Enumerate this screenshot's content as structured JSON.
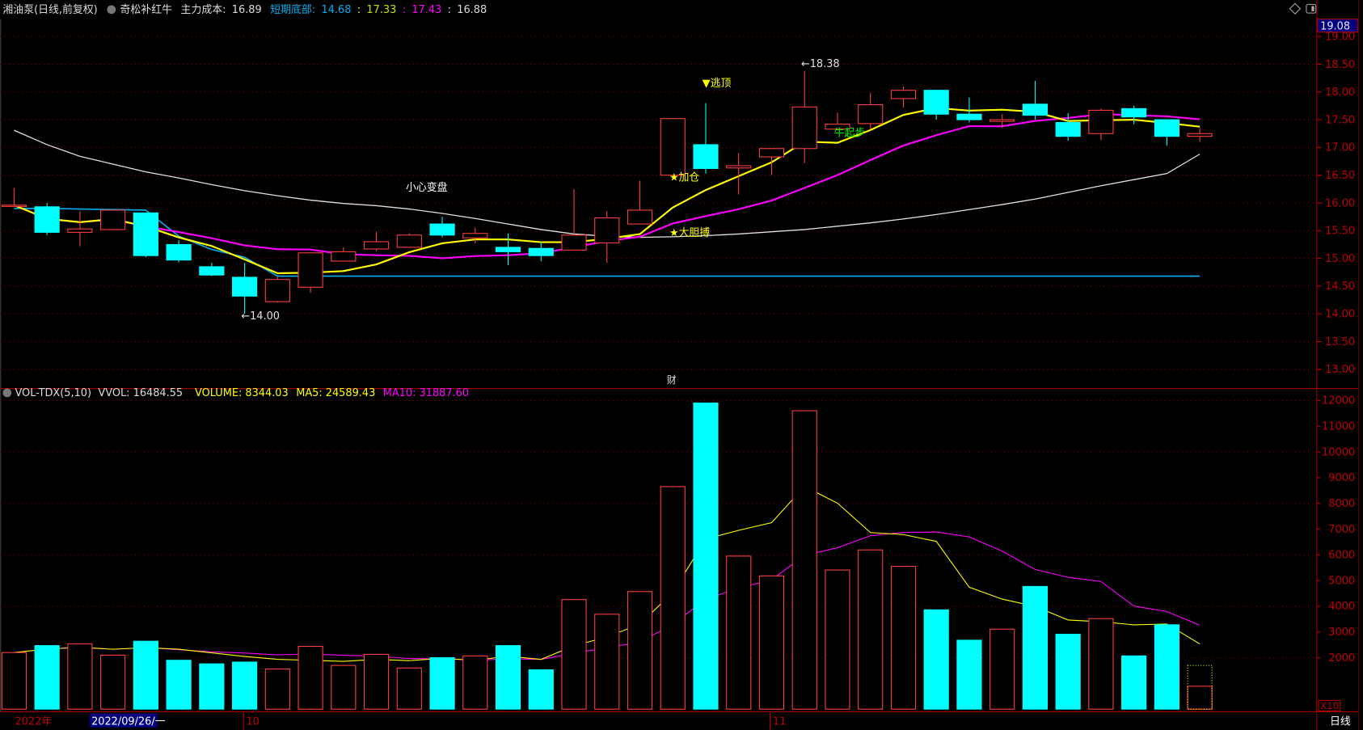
{
  "header": {
    "stock": "湘油泵(日线,前复权)",
    "indicator": "奇松补红牛",
    "cost_label": "主力成本:",
    "cost_value": "16.89",
    "bottom_label": "短期底部:",
    "v1": "14.68",
    "v2": "17.33",
    "v3": "17.43",
    "v4": "16.88",
    "sep": ":"
  },
  "volume_header": {
    "name": "VOL-TDX(5,10)",
    "vvol": "VVOL: 16484.55",
    "volume": "VOLUME: 8344.03",
    "ma5": "MA5: 24589.43",
    "ma10": "MA10: 31887.60"
  },
  "cursor_price": "19.08",
  "volume_unit": "X10",
  "footer": {
    "year": "2022年",
    "cursor_date": "2022/09/26/一",
    "month_10": "10",
    "month_11": "11",
    "period": "日线"
  },
  "finance_marker": "财",
  "colors": {
    "up": "#ff4040",
    "down": "#00ffff",
    "ma_short": "#ffff00",
    "ma_mid": "#ff00ff",
    "ma_long": "#e0e0e0",
    "bottom_line": "#00b0f0",
    "axis": "#c00000",
    "grid": "#800000"
  },
  "chart_data": [
    {
      "type": "candlestick",
      "ylim": [
        13.0,
        19.0
      ],
      "yticks": [
        "19.00",
        "18.50",
        "18.00",
        "17.50",
        "17.00",
        "16.50",
        "16.00",
        "15.50",
        "15.00",
        "14.50",
        "14.00",
        "13.50",
        "13.00"
      ],
      "grid": true,
      "candles_ohlc": [
        [
          15.95,
          16.27,
          15.93,
          15.96
        ],
        [
          15.93,
          16.0,
          15.42,
          15.47
        ],
        [
          15.47,
          15.85,
          15.22,
          15.53
        ],
        [
          15.52,
          15.87,
          15.52,
          15.87
        ],
        [
          15.82,
          15.82,
          15.02,
          15.05
        ],
        [
          15.25,
          15.33,
          14.93,
          14.97
        ],
        [
          14.85,
          14.92,
          14.68,
          14.7
        ],
        [
          14.66,
          14.92,
          14.0,
          14.32
        ],
        [
          14.22,
          14.67,
          14.2,
          14.62
        ],
        [
          14.48,
          15.1,
          14.38,
          15.1
        ],
        [
          14.95,
          15.2,
          14.95,
          15.12
        ],
        [
          15.17,
          15.48,
          15.13,
          15.3
        ],
        [
          15.2,
          15.45,
          15.2,
          15.42
        ],
        [
          15.62,
          15.75,
          15.38,
          15.42
        ],
        [
          15.37,
          15.55,
          15.27,
          15.45
        ],
        [
          15.2,
          15.45,
          14.88,
          15.12
        ],
        [
          15.18,
          15.3,
          14.95,
          15.05
        ],
        [
          15.15,
          16.25,
          15.15,
          15.42
        ],
        [
          15.28,
          15.85,
          14.92,
          15.73
        ],
        [
          15.62,
          16.4,
          15.62,
          15.87
        ],
        [
          16.5,
          17.52,
          16.5,
          17.52
        ],
        [
          17.05,
          17.8,
          16.53,
          16.62
        ],
        [
          16.63,
          16.9,
          16.15,
          16.67
        ],
        [
          16.83,
          16.98,
          16.5,
          16.98
        ],
        [
          16.98,
          18.38,
          16.72,
          17.73
        ],
        [
          17.33,
          17.63,
          17.33,
          17.42
        ],
        [
          17.43,
          17.98,
          17.33,
          17.77
        ],
        [
          17.88,
          18.1,
          17.72,
          18.03
        ],
        [
          18.03,
          18.03,
          17.5,
          17.6
        ],
        [
          17.6,
          17.9,
          17.45,
          17.5
        ],
        [
          17.47,
          17.6,
          17.35,
          17.5
        ],
        [
          17.78,
          18.2,
          17.5,
          17.58
        ],
        [
          17.45,
          17.62,
          17.12,
          17.2
        ],
        [
          17.25,
          17.7,
          17.13,
          17.67
        ],
        [
          17.7,
          17.75,
          17.42,
          17.55
        ],
        [
          17.5,
          17.5,
          17.03,
          17.2
        ],
        [
          17.2,
          17.35,
          17.1,
          17.25
        ]
      ],
      "ma_long": [
        17.31,
        17.05,
        16.84,
        16.7,
        16.56,
        16.45,
        16.33,
        16.22,
        16.13,
        16.05,
        15.99,
        15.95,
        15.89,
        15.81,
        15.72,
        15.62,
        15.52,
        15.44,
        15.4,
        15.38,
        15.39,
        15.41,
        15.44,
        15.48,
        15.52,
        15.58,
        15.64,
        15.71,
        15.79,
        15.88,
        15.97,
        16.07,
        16.19,
        16.31,
        16.42,
        16.53,
        16.88
      ],
      "bottom_line": [
        15.9,
        15.9,
        15.89,
        15.88,
        15.87,
        15.4,
        15.16,
        15.02,
        14.68,
        14.68,
        14.68,
        14.68,
        14.68,
        14.68,
        14.68,
        14.68,
        14.68,
        14.68,
        14.68,
        14.68,
        14.68,
        14.68,
        14.68,
        14.68,
        14.68,
        14.68,
        14.68,
        14.68,
        14.68,
        14.68,
        14.68,
        14.68,
        14.68,
        14.68,
        14.68,
        14.68,
        14.68
      ],
      "annotations": [
        {
          "text": "小心变盘",
          "candle": 12,
          "price": 16.22,
          "color": "#ffffff"
        },
        {
          "text": "▼逃顶",
          "candle": 21,
          "price": 18.1,
          "color": "#ffff00"
        },
        {
          "text": "★加仓",
          "candle": 20,
          "price": 16.4,
          "color": "#ffff00"
        },
        {
          "text": "★大胆搏",
          "candle": 20,
          "price": 15.4,
          "color": "#ffff00"
        },
        {
          "text": "牛起步",
          "candle": 25,
          "price": 17.2,
          "color": "#00ff00"
        },
        {
          "text": "←14.00",
          "candle": 7,
          "price": 13.9,
          "color": "#e0e0e0"
        },
        {
          "text": "←18.38",
          "candle": 24,
          "price": 18.45,
          "color": "#e0e0e0"
        }
      ]
    },
    {
      "type": "bar",
      "ylim": [
        0,
        12000
      ],
      "yticks": [
        "12000",
        "11000",
        "10000",
        "9000",
        "8000",
        "7000",
        "6000",
        "5000",
        "4000",
        "3000",
        "2000"
      ],
      "values": [
        2200,
        2470,
        2540,
        2100,
        2640,
        1900,
        1760,
        1830,
        1560,
        2440,
        1700,
        2130,
        1600,
        2000,
        2070,
        2470,
        1530,
        4260,
        3690,
        4570,
        8650,
        11900,
        5950,
        5180,
        11600,
        5410,
        6190,
        5550,
        3860,
        2680,
        3110,
        4770,
        2910,
        3520,
        2070,
        3280,
        890
      ],
      "projected_last": 1700
    }
  ]
}
